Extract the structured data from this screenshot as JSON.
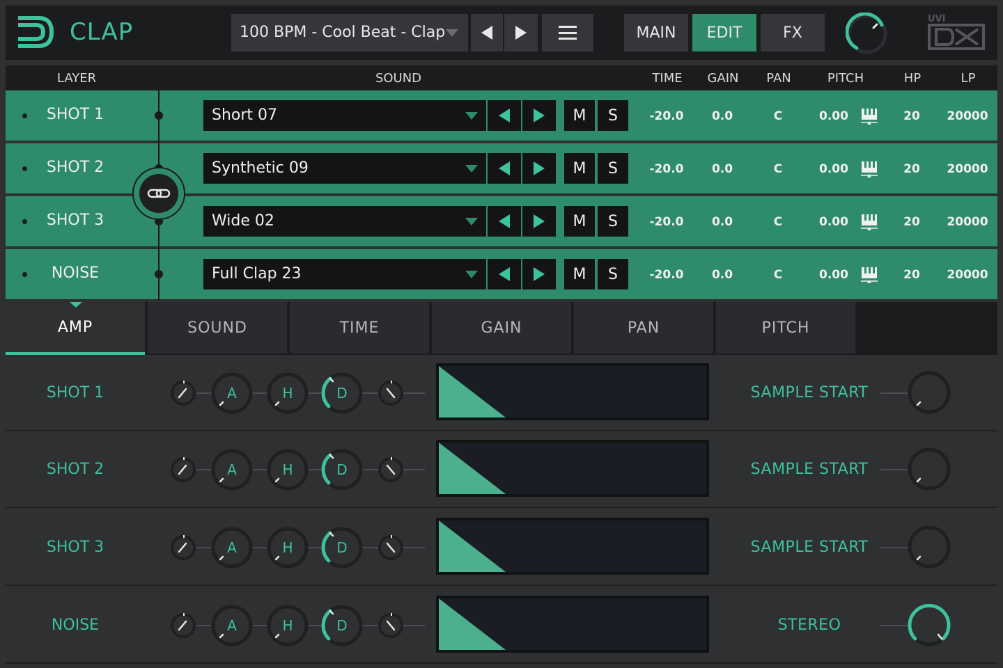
{
  "header": {
    "app_title": "CLAP",
    "preset_name": "100 BPM - Cool Beat - Clap",
    "tabs": [
      {
        "label": "MAIN",
        "active": false
      },
      {
        "label": "EDIT",
        "active": true
      },
      {
        "label": "FX",
        "active": false
      }
    ],
    "brand": "UVI"
  },
  "columns": {
    "layer": "LAYER",
    "sound": "SOUND",
    "time": "TIME",
    "gain": "GAIN",
    "pan": "PAN",
    "pitch": "PITCH",
    "hp": "HP",
    "lp": "LP"
  },
  "layers": [
    {
      "name": "SHOT 1",
      "sound": "Short 07",
      "mute": "M",
      "solo": "S",
      "time": "-20.0",
      "gain": "0.0",
      "pan": "C",
      "pitch": "0.00",
      "hp": "20",
      "lp": "20000"
    },
    {
      "name": "SHOT 2",
      "sound": "Synthetic 09",
      "mute": "M",
      "solo": "S",
      "time": "-20.0",
      "gain": "0.0",
      "pan": "C",
      "pitch": "0.00",
      "hp": "20",
      "lp": "20000"
    },
    {
      "name": "SHOT 3",
      "sound": "Wide 02",
      "mute": "M",
      "solo": "S",
      "time": "-20.0",
      "gain": "0.0",
      "pan": "C",
      "pitch": "0.00",
      "hp": "20",
      "lp": "20000"
    },
    {
      "name": "NOISE",
      "sound": "Full Clap 23",
      "mute": "M",
      "solo": "S",
      "time": "-20.0",
      "gain": "0.0",
      "pan": "C",
      "pitch": "0.00",
      "hp": "20",
      "lp": "20000"
    }
  ],
  "edit_tabs": [
    {
      "label": "AMP",
      "active": true
    },
    {
      "label": "SOUND",
      "active": false
    },
    {
      "label": "TIME",
      "active": false
    },
    {
      "label": "GAIN",
      "active": false
    },
    {
      "label": "PAN",
      "active": false
    },
    {
      "label": "PITCH",
      "active": false
    }
  ],
  "amp_rows": [
    {
      "name": "SHOT 1",
      "attack_label": "A",
      "hold_label": "H",
      "decay_label": "D",
      "right_label": "SAMPLE START",
      "right_knob_active": false
    },
    {
      "name": "SHOT 2",
      "attack_label": "A",
      "hold_label": "H",
      "decay_label": "D",
      "right_label": "SAMPLE START",
      "right_knob_active": false
    },
    {
      "name": "SHOT 3",
      "attack_label": "A",
      "hold_label": "H",
      "decay_label": "D",
      "right_label": "SAMPLE START",
      "right_knob_active": false
    },
    {
      "name": "NOISE",
      "attack_label": "A",
      "hold_label": "H",
      "decay_label": "D",
      "right_label": "STEREO",
      "right_knob_active": true
    }
  ],
  "colors": {
    "accent": "#3cc39a",
    "row_green": "#2f8c6a",
    "panel_dark": "#1b1c1e",
    "panel_mid": "#2f3031"
  }
}
